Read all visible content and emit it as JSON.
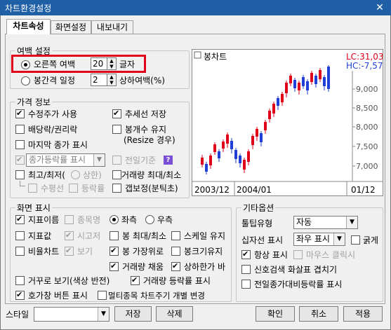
{
  "window": {
    "title": "차트환경설정",
    "close_icon": "close-icon"
  },
  "tabs": [
    {
      "label": "차트속성",
      "active": true
    },
    {
      "label": "화면설정",
      "active": false
    },
    {
      "label": "내보내기",
      "active": false
    }
  ],
  "margin": {
    "group_label": "여백 설정",
    "right_margin_label": "오른쪽 여백",
    "right_margin_value": "20",
    "right_margin_unit": "글자",
    "candle_gap_label": "봉간격 일정",
    "candle_gap_value": "2",
    "candle_gap_unit": "상하여백(%)"
  },
  "price": {
    "group_label": "가격 정보",
    "adj_price": "수정주가 사용",
    "trendline_save": "추세선 저장",
    "dividend": "배당락/권리락",
    "candle_keep": "봉개수 유지",
    "resize_note": "(Resize 경우)",
    "last_price": "마지막 종가 표시",
    "rate_show": "종가등락률 표시",
    "prev_base": "전일기준",
    "question": "?",
    "high_low": "최고/최저(",
    "high_low_opt": "상한)",
    "volume_hl": "거래량 최대/최소",
    "sub_flat": "수평선",
    "sub_rate": "등락률",
    "gap_adjust": "갭보정(분틱초)"
  },
  "preview": {
    "title": "봉차트",
    "lc": "LC:31,03",
    "hc": "HC:-7,57",
    "y_ticks": [
      "9,000",
      "8,500",
      "8,000",
      "7,500",
      "7,000"
    ],
    "x_left": "2003/12",
    "x_mid": "2004/01",
    "x_right": "01/12",
    "up_color": "#e0001a",
    "down_color": "#1f3fd6"
  },
  "screen": {
    "group_label": "화면 표시",
    "indicator_name": "지표이름",
    "item_name": "종목명",
    "left": "좌측",
    "right": "우측",
    "indicator_value": "지표값",
    "time_axis": "시고저",
    "candle_hl": "봉 최대/최소",
    "scale_keep": "스케일 유지",
    "ratio_chart": "비율차트",
    "view": "보기",
    "candle_top": "봉 가장위로",
    "candle_width": "봉크기유지",
    "volume_fill": "거래량 채움",
    "upper_lower": "상하한가 바",
    "reverse_view": "거꾸로 보기(색상 반전)",
    "volume_rate": "거래량 등락률 표시",
    "hoga_button": "호가창 버튼 표시",
    "multi_item": "멀티종목 차트주기 개별 변경"
  },
  "etc": {
    "group_label": "기타옵션",
    "tooltip_label": "툴팁유형",
    "tooltip_value": "자동",
    "crosshair_label": "십자선 표시",
    "crosshair_value": "좌우 표시",
    "bold": "굵게",
    "always_show": "항상 표시",
    "mouse_click": "마우스 클릭시",
    "signal_overlap": "신호검색 화살표 겹치기",
    "prev_close_rate": "전일종가대비등락률 표시"
  },
  "bottom": {
    "style_label": "스타일",
    "style_value": "",
    "save": "저장",
    "delete": "삭제",
    "ok": "확인",
    "cancel": "취소",
    "apply": "적용"
  }
}
